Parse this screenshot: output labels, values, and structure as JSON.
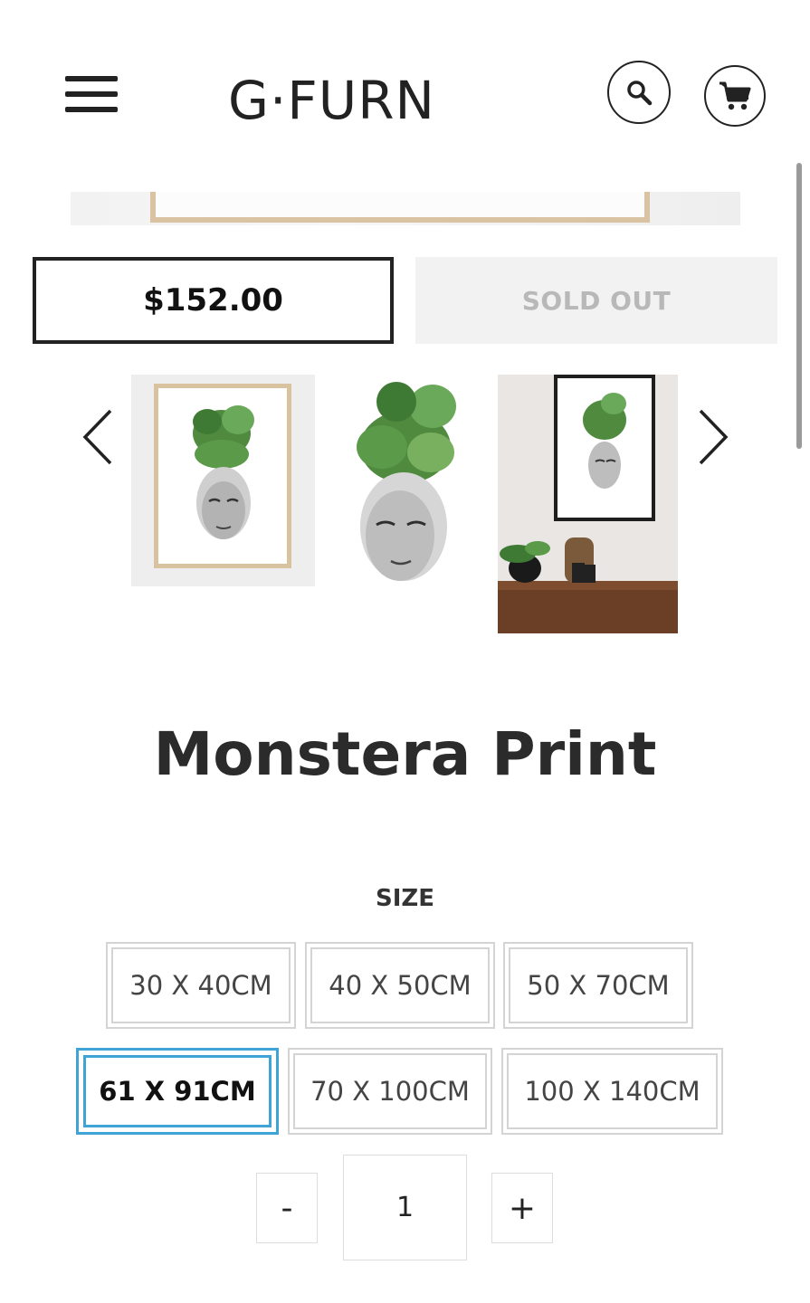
{
  "header": {
    "logo": "G·FURN",
    "menu_icon": "hamburger-menu-icon",
    "search_icon": "search-icon",
    "cart_icon": "cart-icon"
  },
  "purchase": {
    "price": "$152.00",
    "availability": "SOLD OUT"
  },
  "carousel": {
    "prev_icon": "chevron-left-icon",
    "next_icon": "chevron-right-icon",
    "thumbnail_count": 3
  },
  "product": {
    "title": "Monstera Print"
  },
  "options": {
    "size_label": "SIZE",
    "sizes": [
      "30 X 40CM",
      "40 X 50CM",
      "50 X 70CM",
      "61 X 91CM",
      "70 X 100CM",
      "100 X 140CM"
    ],
    "selected_size": "61 X 91CM"
  },
  "quantity": {
    "decrement_label": "-",
    "value": "1",
    "increment_label": "+"
  },
  "colors": {
    "text": "#222222",
    "selected_accent": "#3fa3d6",
    "sold_out_bg": "#f2f2f2",
    "sold_out_text": "#b8b8b8",
    "option_border": "#d4d4d4"
  }
}
